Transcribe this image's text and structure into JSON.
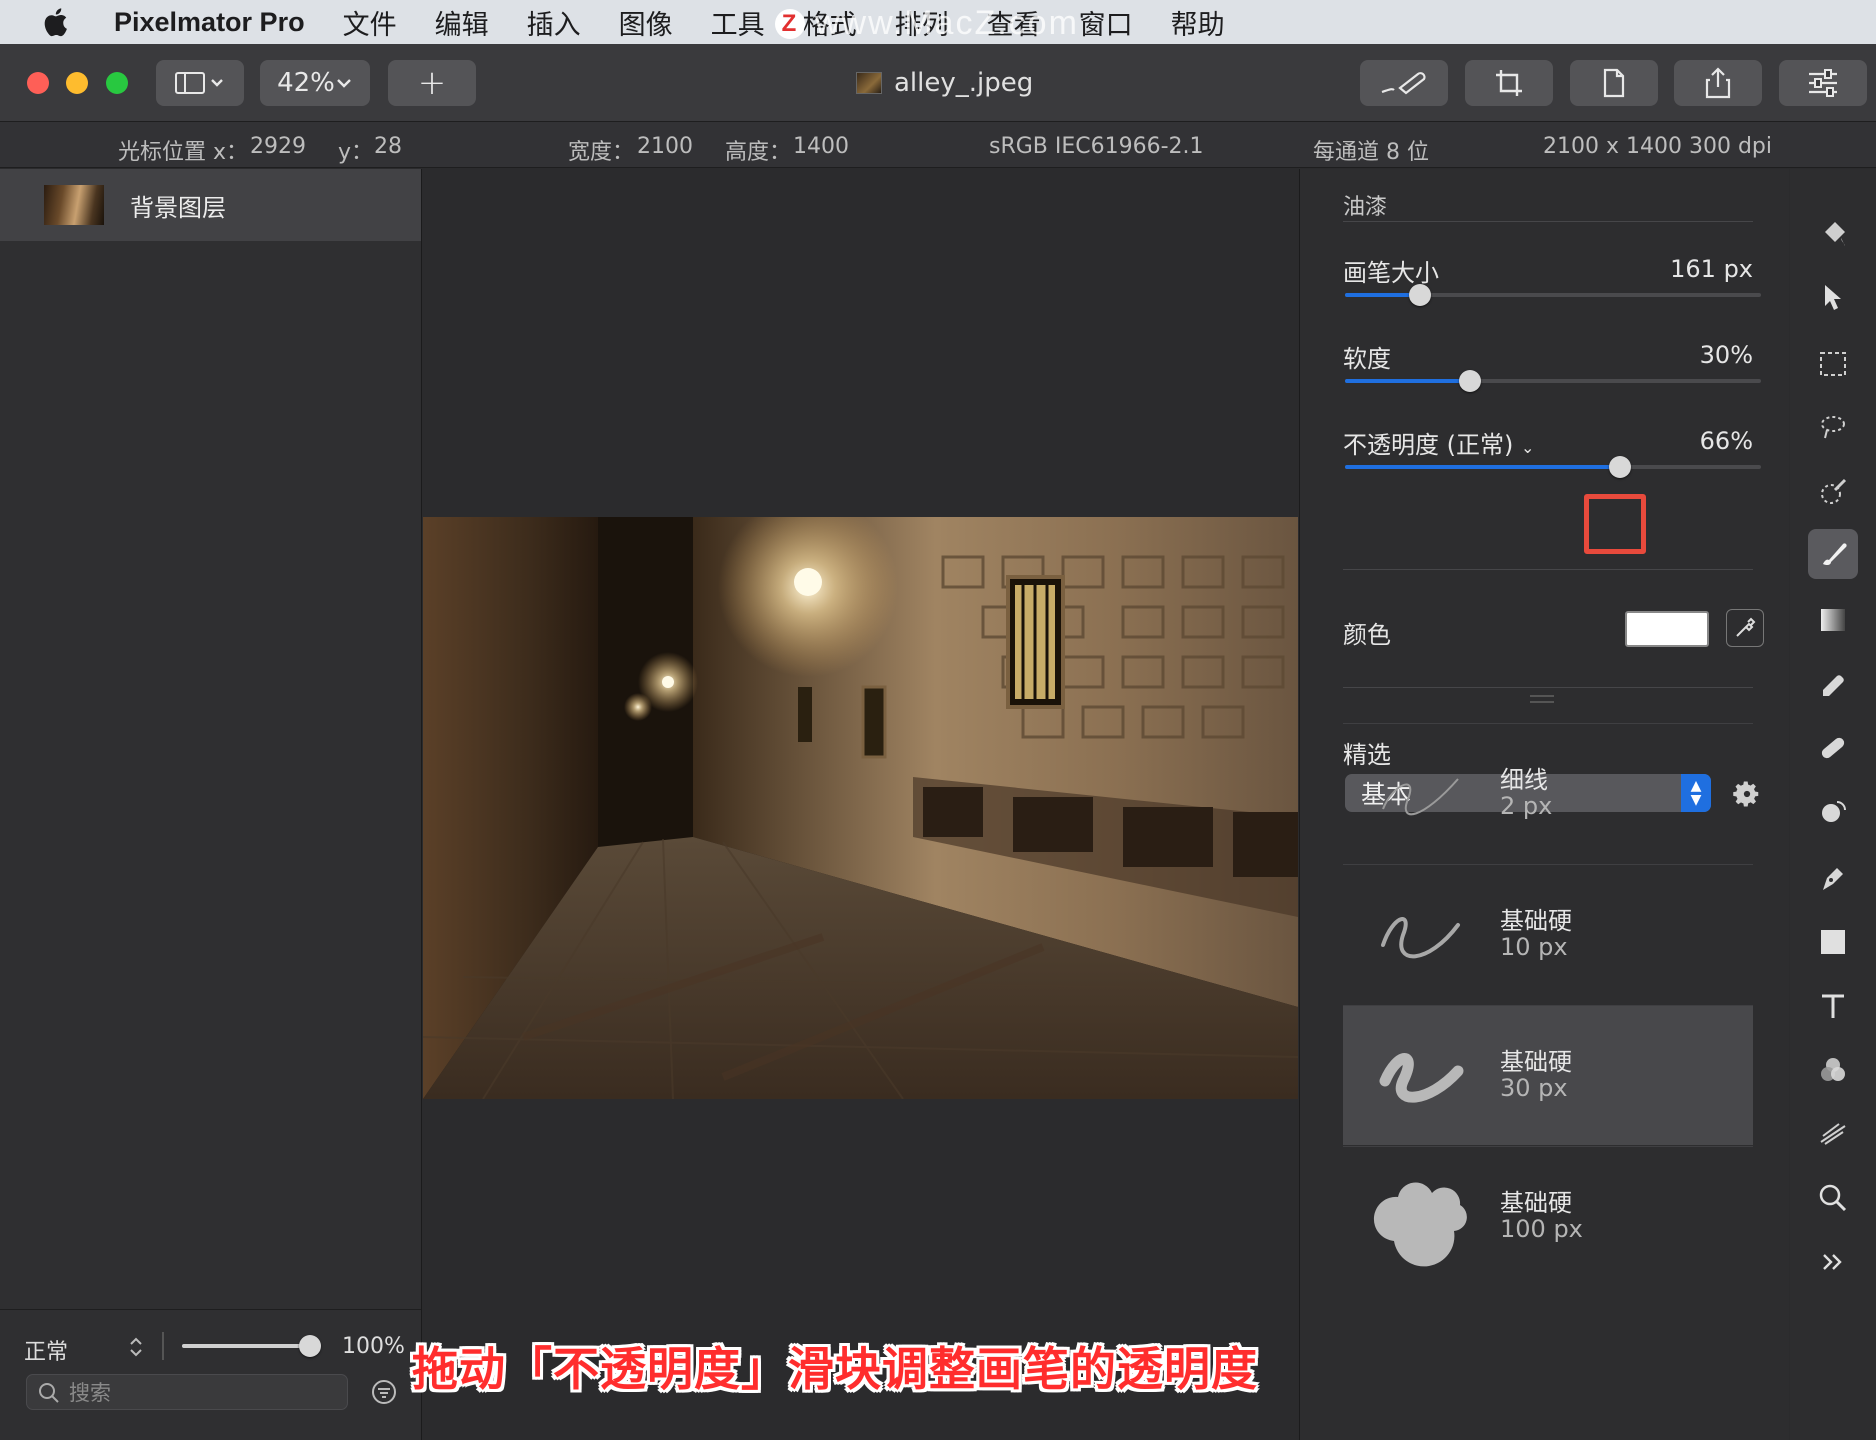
{
  "menubar": {
    "app_name": "Pixelmator Pro",
    "items": [
      "文件",
      "编辑",
      "插入",
      "图像",
      "工具",
      "格式",
      "排列",
      "查看",
      "窗口",
      "帮助"
    ],
    "watermark": "www.MacZ.com",
    "watermark_badge": "Z"
  },
  "toolbar": {
    "zoom": "42%",
    "add_label": "+",
    "doc_title": "alley_.jpeg"
  },
  "infobar": {
    "cursor_x_label": "光标位置 x：",
    "cursor_x": "2929",
    "cursor_y_label": "y：",
    "cursor_y": "28",
    "width_label": "宽度：",
    "width": "2100",
    "height_label": "高度：",
    "height": "1400",
    "color_profile": "sRGB IEC61966-2.1",
    "bit_depth": "每通道 8 位",
    "dimensions": "2100 x 1400 300 dpi"
  },
  "layers": {
    "items": [
      {
        "name": "背景图层"
      }
    ],
    "blend_mode": "正常",
    "opacity": "100%",
    "opacity_value": 1.0,
    "search_placeholder": "搜索"
  },
  "panel": {
    "section_title": "油漆",
    "brush_size_label": "画笔大小",
    "brush_size_value": "161 px",
    "brush_size_fraction": 0.18,
    "softness_label": "软度",
    "softness_value": "30%",
    "softness_fraction": 0.3,
    "opacity_label": "不透明度 (正常)",
    "opacity_value": "66%",
    "opacity_fraction": 0.66,
    "color_label": "颜色",
    "color_value": "#ffffff",
    "presets_label": "精选",
    "preset_selected": "基本",
    "brushes": [
      {
        "name": "细线",
        "size": "2 px"
      },
      {
        "name": "基础硬",
        "size": "10 px"
      },
      {
        "name": "基础硬",
        "size": "30 px"
      },
      {
        "name": "基础硬",
        "size": "100 px"
      }
    ]
  },
  "tools": [
    "paint-bucket-icon",
    "arrange-arrow-icon",
    "rect-select-icon",
    "magic-wand-icon",
    "quick-select-icon",
    "paint-brush-icon",
    "gradient-icon",
    "eraser-icon",
    "repair-icon",
    "retouch-icon",
    "pen-icon",
    "shape-icon",
    "type-icon",
    "color-adjust-icon",
    "effects-icon",
    "zoom-icon",
    "more-tools-icon"
  ],
  "caption": "拖动「不透明度」滑块调整画笔的透明度",
  "colors": {
    "accent": "#1f6fe0",
    "highlight": "#e84a3c",
    "caption": "#ff2d2d"
  }
}
